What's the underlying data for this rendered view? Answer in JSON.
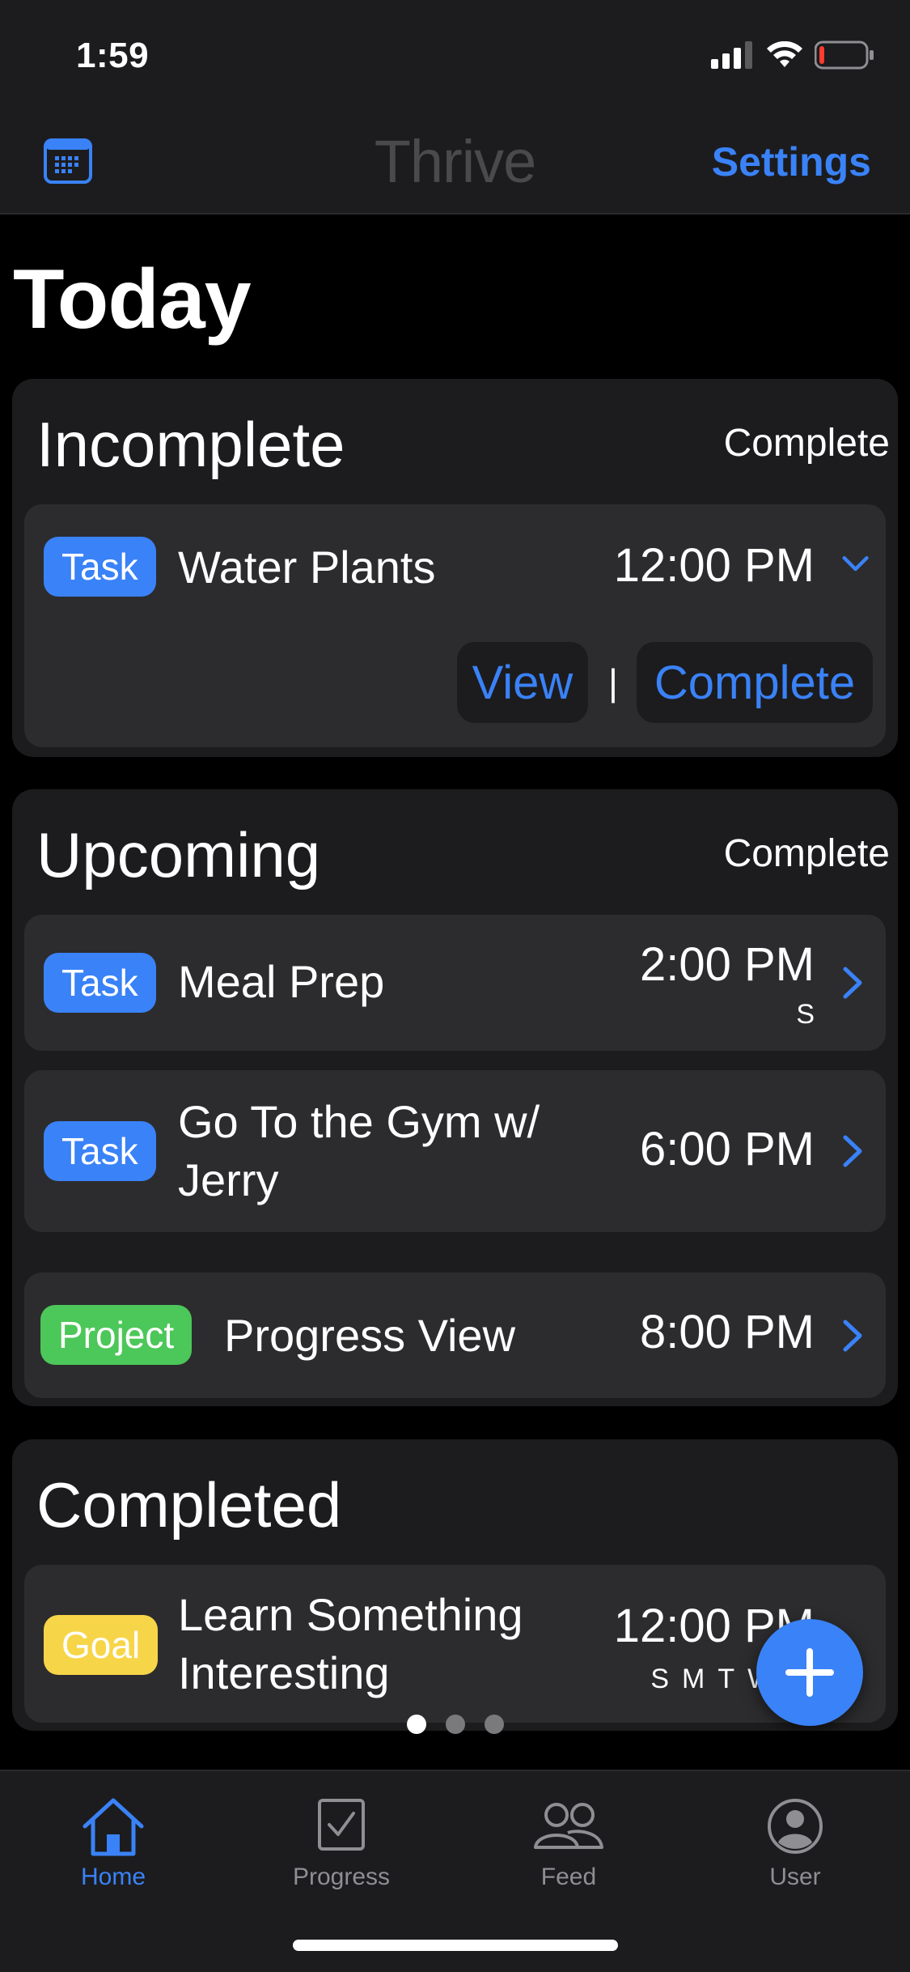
{
  "status_bar": {
    "time": "1:59"
  },
  "nav": {
    "title": "Thrive",
    "settings_label": "Settings"
  },
  "page": {
    "title": "Today"
  },
  "incomplete": {
    "title": "Incomplete",
    "action": "Complete",
    "items": [
      {
        "badge": "Task",
        "title": "Water Plants",
        "time": "12:00 PM",
        "view_label": "View",
        "separator": "|",
        "complete_label": "Complete"
      }
    ]
  },
  "upcoming": {
    "title": "Upcoming",
    "action": "Complete",
    "items": [
      {
        "badge": "Task",
        "title": "Meal Prep",
        "time": "2:00 PM",
        "sub": "S"
      },
      {
        "badge": "Task",
        "title_line1": "Go To the Gym w/",
        "title_line2": "Jerry",
        "time": "6:00 PM"
      },
      {
        "badge": "Project",
        "title": "Progress View",
        "time": "8:00 PM"
      }
    ]
  },
  "completed": {
    "title": "Completed",
    "items": [
      {
        "badge": "Goal",
        "title_line1": "Learn Something",
        "title_line2": "Interesting",
        "time": "12:00 PM",
        "sub": "SMTWT"
      }
    ]
  },
  "tabs": [
    {
      "label": "Home",
      "icon": "home-icon",
      "active": true
    },
    {
      "label": "Progress",
      "icon": "checkbox-icon",
      "active": false
    },
    {
      "label": "Feed",
      "icon": "people-icon",
      "active": false
    },
    {
      "label": "User",
      "icon": "user-circle-icon",
      "active": false
    }
  ],
  "colors": {
    "accent": "#3a82f7",
    "task": "#3a82f7",
    "project": "#4cc759",
    "goal": "#f7d548",
    "background": "#000000",
    "card": "#1c1c1e",
    "row": "#2c2c2e"
  }
}
